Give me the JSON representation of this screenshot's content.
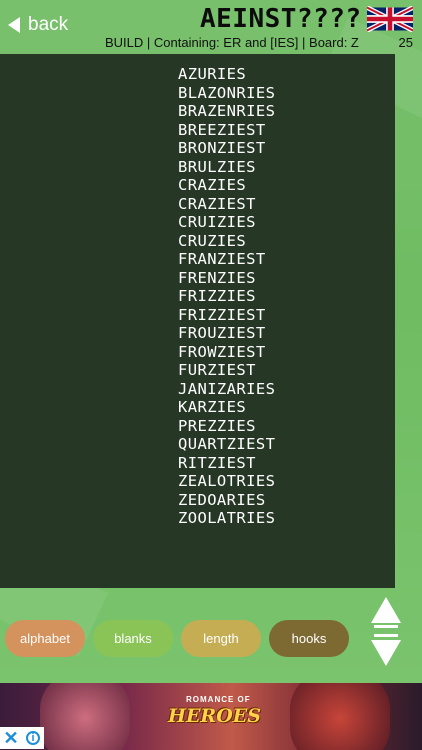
{
  "header": {
    "back_label": "back",
    "rack": "AEINST????",
    "subinfo": "BUILD | Containing: ER and [IES] | Board: Z",
    "count": "25"
  },
  "words": [
    "AZURIES",
    "BLAZONRIES",
    "BRAZENRIES",
    "BREEZIEST",
    "BRONZIEST",
    "BRULZIES",
    "CRAZIES",
    "CRAZIEST",
    "CRUIZIES",
    "CRUZIES",
    "FRANZIEST",
    "FRENZIES",
    "FRIZZIES",
    "FRIZZIEST",
    "FROUZIEST",
    "FROWZIEST",
    "FURZIEST",
    "JANIZARIES",
    "KARZIES",
    "PREZZIES",
    "QUARTZIEST",
    "RITZIEST",
    "ZEALOTRIES",
    "ZEDOARIES",
    "ZOOLATRIES"
  ],
  "sort_buttons": {
    "alphabet": "alphabet",
    "blanks": "blanks",
    "length": "length",
    "hooks": "hooks"
  },
  "ad": {
    "title": "HEROES",
    "subtitle": "ROMANCE OF"
  },
  "colors": {
    "panel": "#263726",
    "alphabet": "#d4925c",
    "blanks": "#8ac457",
    "length": "#c5ad54",
    "hooks": "#7d6a33"
  }
}
